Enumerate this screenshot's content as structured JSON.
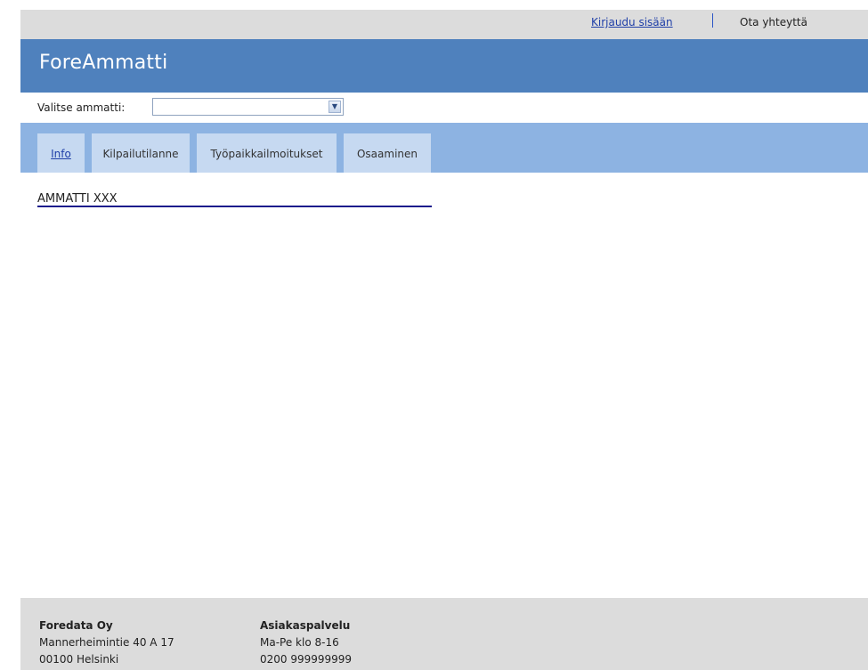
{
  "topbar": {
    "login_label": "Kirjaudu sisään",
    "contact_label": "Ota yhteyttä"
  },
  "header": {
    "title": "ForeAmmatti"
  },
  "selector": {
    "label": "Valitse ammatti:",
    "value": ""
  },
  "tabs": [
    {
      "label": "Info",
      "active": true
    },
    {
      "label": "Kilpailutilanne",
      "active": false
    },
    {
      "label": "Työpaikkailmoitukset",
      "active": false
    },
    {
      "label": "Osaaminen",
      "active": false
    }
  ],
  "content": {
    "title": "AMMATTI XXX"
  },
  "footer": {
    "company": {
      "name": "Foredata Oy",
      "street": "Mannerheimintie 40 A 17",
      "city": "00100 Helsinki"
    },
    "service": {
      "name": "Asiakaspalvelu",
      "hours": "Ma-Pe klo 8-16",
      "phone": "0200 999999999"
    }
  },
  "colors": {
    "header": "#4f81bd",
    "tabbar": "#8db3e2",
    "tab": "#c6d9f1",
    "page_bg": "#dcdcdc",
    "link": "#1f3fa8"
  }
}
